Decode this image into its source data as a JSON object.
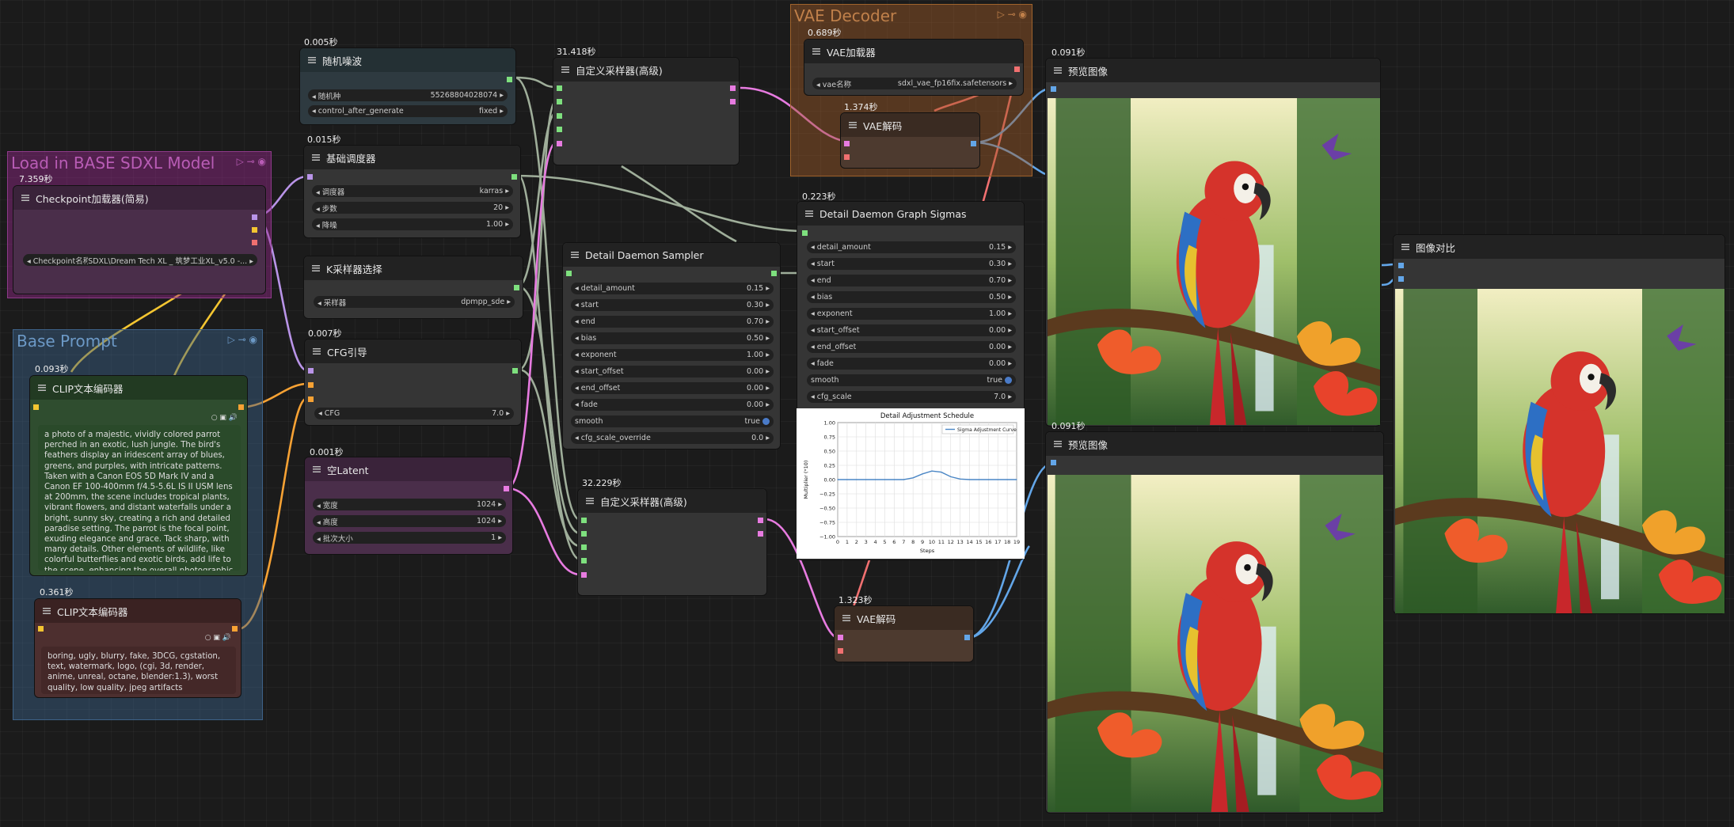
{
  "groups": {
    "base_model": {
      "title": "Load in BASE SDXL Model"
    },
    "base_prompt": {
      "title": "Base Prompt"
    },
    "vae_decoder": {
      "title": "VAE Decoder"
    }
  },
  "nodes": {
    "checkpoint": {
      "time": "7.359秒",
      "title": "Checkpoint加载器(简易)",
      "widgets": [
        {
          "label": "Checkpoint名称",
          "value": "SDXL\\Dream Tech XL _ 筑梦工业XL_v5.0 -..."
        }
      ]
    },
    "random_noise": {
      "time": "0.005秒",
      "title": "随机噪波",
      "widgets": [
        {
          "label": "随机种",
          "value": "552688040280​74"
        },
        {
          "label": "control_after_generate",
          "value": "fixed"
        }
      ]
    },
    "basic_scheduler": {
      "time": "0.015秒",
      "title": "基础调度器",
      "widgets": [
        {
          "label": "调度器",
          "value": "karras"
        },
        {
          "label": "步数",
          "value": "20"
        },
        {
          "label": "降噪",
          "value": "1.00"
        }
      ]
    },
    "ksampler_select": {
      "title": "K采样器选择",
      "widgets": [
        {
          "label": "采样器",
          "value": "dpmpp_sde"
        }
      ]
    },
    "cfg_guide": {
      "time": "0.007秒",
      "title": "CFG引导",
      "widgets": [
        {
          "label": "CFG",
          "value": "7.0"
        }
      ]
    },
    "empty_latent": {
      "time": "0.001秒",
      "title": "空Latent",
      "widgets": [
        {
          "label": "宽度",
          "value": "1024"
        },
        {
          "label": "高度",
          "value": "1024"
        },
        {
          "label": "批次大小",
          "value": "1"
        }
      ]
    },
    "clip_pos": {
      "time": "0.093秒",
      "title": "CLIP文本编码器",
      "text": "a photo of a majestic, vividly colored parrot perched in an exotic, lush jungle. The bird's feathers display an iridescent array of blues, greens, and purples, with intricate patterns. Taken with a Canon EOS 5D Mark IV and a Canon EF 100-400mm f/4.5-5.6L IS II USM lens at 200mm, the scene includes tropical plants, vibrant flowers, and distant waterfalls under a bright, sunny sky, creating a rich and detailed paradise setting. The parrot is the focal point, exuding elegance and grace. Tack sharp, with many details. Other elements of wildlife, like colorful butterflies and exotic birds, add life to the scene, enhancing the overall photographic quality."
    },
    "clip_neg": {
      "time": "0.361秒",
      "title": "CLIP文本编码器",
      "text": "boring, ugly, blurry, fake, 3DCG, cgstation, text, watermark, logo, (cgi, 3d, render, anime, unreal, octane, blender:1.3), worst quality, low quality, jpeg artifacts"
    },
    "sampler_adv1": {
      "time": "31.418秒",
      "title": "自定义采样器(高级)"
    },
    "sampler_adv2": {
      "time": "32.229秒",
      "title": "自定义采样器(高级)"
    },
    "dd_sampler": {
      "title": "Detail Daemon Sampler",
      "widgets": [
        {
          "label": "detail_amount",
          "value": "0.15"
        },
        {
          "label": "start",
          "value": "0.30"
        },
        {
          "label": "end",
          "value": "0.70"
        },
        {
          "label": "bias",
          "value": "0.50"
        },
        {
          "label": "exponent",
          "value": "1.00"
        },
        {
          "label": "start_offset",
          "value": "0.00"
        },
        {
          "label": "end_offset",
          "value": "0.00"
        },
        {
          "label": "fade",
          "value": "0.00"
        },
        {
          "label": "smooth",
          "value": "true"
        },
        {
          "label": "cfg_scale_override",
          "value": "0.0"
        }
      ]
    },
    "dd_graph": {
      "time": "0.223秒",
      "title": "Detail Daemon Graph Sigmas",
      "widgets": [
        {
          "label": "detail_amount",
          "value": "0.15"
        },
        {
          "label": "start",
          "value": "0.30"
        },
        {
          "label": "end",
          "value": "0.70"
        },
        {
          "label": "bias",
          "value": "0.50"
        },
        {
          "label": "exponent",
          "value": "1.00"
        },
        {
          "label": "start_offset",
          "value": "0.00"
        },
        {
          "label": "end_offset",
          "value": "0.00"
        },
        {
          "label": "fade",
          "value": "0.00"
        },
        {
          "label": "smooth",
          "value": "true"
        },
        {
          "label": "cfg_scale",
          "value": "7.0"
        }
      ]
    },
    "vae_loader": {
      "time": "0.689秒",
      "title": "VAE加载器",
      "widgets": [
        {
          "label": "vae名称",
          "value": "sdxl_vae_fp16fix.safetensors"
        }
      ]
    },
    "vae_decode1": {
      "time": "1.374秒",
      "title": "VAE解码"
    },
    "vae_decode2": {
      "time": "1.323秒",
      "title": "VAE解码"
    },
    "preview1": {
      "time": "0.091秒",
      "title": "预览图像"
    },
    "preview2": {
      "time": "0.091秒",
      "title": "预览图像"
    },
    "compare": {
      "title": "图像对比"
    }
  },
  "chart_data": {
    "type": "line",
    "title": "Detail Adjustment Schedule",
    "xlabel": "Steps",
    "ylabel": "Multiplier (*10)",
    "x": [
      0,
      1,
      2,
      3,
      4,
      5,
      6,
      7,
      8,
      9,
      10,
      11,
      12,
      13,
      14,
      15,
      16,
      17,
      18,
      19
    ],
    "xticks": [
      "0",
      "1",
      "2",
      "3",
      "4",
      "5",
      "6",
      "7",
      "8",
      "9",
      "10",
      "11",
      "12",
      "13",
      "14",
      "15",
      "16",
      "17",
      "18",
      "19"
    ],
    "yticks": [
      "1.00",
      "0.75",
      "0.50",
      "0.25",
      "0.00",
      "−0.25",
      "−0.50",
      "−0.75",
      "−1.00"
    ],
    "ylim": [
      -1.0,
      1.0
    ],
    "grid": true,
    "legend_position": "top-right",
    "series": [
      {
        "name": "Sigma Adjustment Curve",
        "color": "#4a86c5",
        "values": [
          0,
          0,
          0,
          0,
          0,
          0,
          0,
          0,
          0.03,
          0.1,
          0.15,
          0.13,
          0.05,
          0.01,
          0,
          0,
          0,
          0,
          0,
          0
        ]
      }
    ]
  },
  "colors": {
    "wire_pink": "#e77be0",
    "wire_yellow": "#f3c531",
    "wire_orange": "#f7a234",
    "wire_blue": "#63a6e8",
    "wire_gray": "#9fae9a",
    "wire_red": "#f07070",
    "wire_lilac": "#b994e8"
  }
}
